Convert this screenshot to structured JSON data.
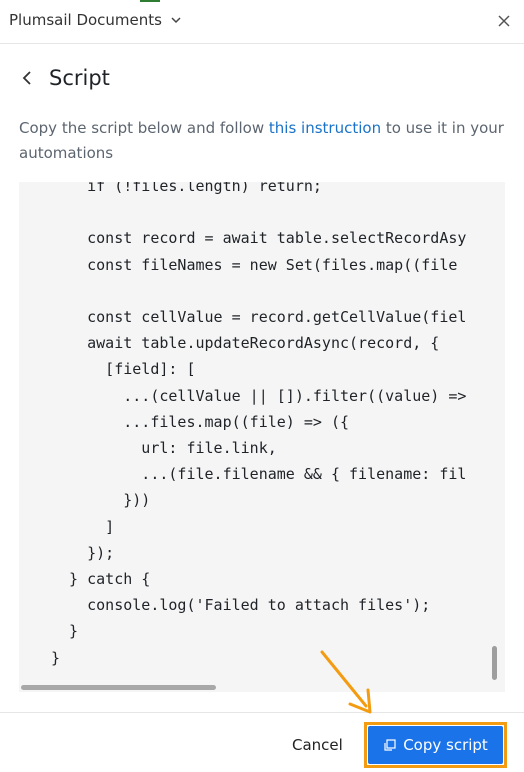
{
  "window": {
    "title": "Plumsail Documents"
  },
  "header": {
    "title": "Script"
  },
  "description": {
    "before": "Copy the script below and follow ",
    "link": "this instruction",
    "after": " to use it in your automations"
  },
  "code_lines": [
    "    if (!files.length) return;",
    "",
    "    const record = await table.selectRecordAsy",
    "    const fileNames = new Set(files.map((file",
    "",
    "    const cellValue = record.getCellValue(fiel",
    "    await table.updateRecordAsync(record, {",
    "      [field]: [",
    "        ...(cellValue || []).filter((value) =>",
    "        ...files.map((file) => ({",
    "          url: file.link,",
    "          ...(file.filename && { filename: fil",
    "        }))",
    "      ]",
    "    });",
    "  } catch {",
    "    console.log('Failed to attach files');",
    "  }",
    "}"
  ],
  "footer": {
    "cancel_label": "Cancel",
    "copy_label": "Copy script"
  },
  "colors": {
    "accent": "#1a73e8",
    "highlight": "#f39c12",
    "link": "#1a73c8"
  },
  "icons": [
    "chevron-down-icon",
    "close-icon",
    "back-arrow-icon",
    "copy-icon",
    "pointer-arrow-icon"
  ]
}
